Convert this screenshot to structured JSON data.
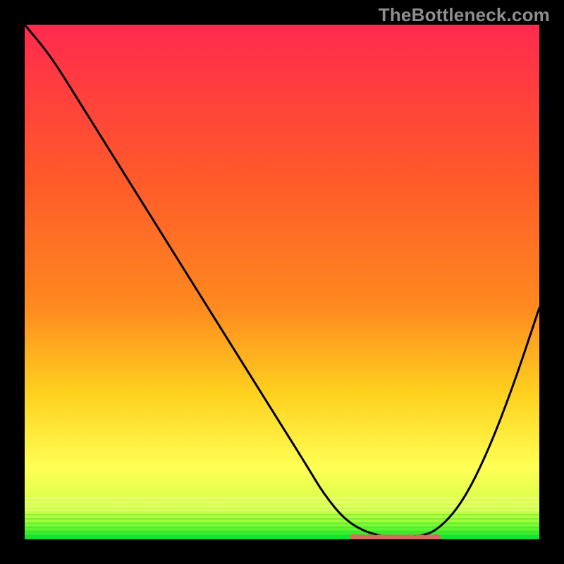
{
  "watermark": "TheBottleneck.com",
  "colors": {
    "frame": "#000000",
    "gradient_top": "#ff2a4d",
    "gradient_mid1": "#ff8a1f",
    "gradient_mid2": "#ffd21f",
    "gradient_mid3": "#ffff54",
    "gradient_bottom": "#00e22a",
    "curve": "#000000",
    "marker": "#d86a60"
  },
  "chart_data": {
    "type": "line",
    "title": "",
    "xlabel": "",
    "ylabel": "",
    "xlim": [
      0,
      100
    ],
    "ylim": [
      0,
      100
    ],
    "grid": false,
    "legend": false,
    "series": [
      {
        "name": "bottleneck-curve",
        "x": [
          0,
          5,
          10,
          15,
          20,
          25,
          30,
          35,
          40,
          45,
          50,
          55,
          58,
          62,
          66,
          70,
          73,
          76,
          80,
          85,
          90,
          95,
          100
        ],
        "y": [
          100,
          94,
          86,
          78,
          70,
          62,
          54,
          46,
          38,
          30,
          22,
          14,
          9,
          4,
          1.5,
          0.5,
          0.5,
          0.5,
          1.5,
          7,
          17,
          30,
          45
        ]
      }
    ],
    "highlight_segment": {
      "name": "optimal-range",
      "x_start": 64,
      "x_end": 80,
      "y": 0.5
    },
    "annotations": []
  }
}
